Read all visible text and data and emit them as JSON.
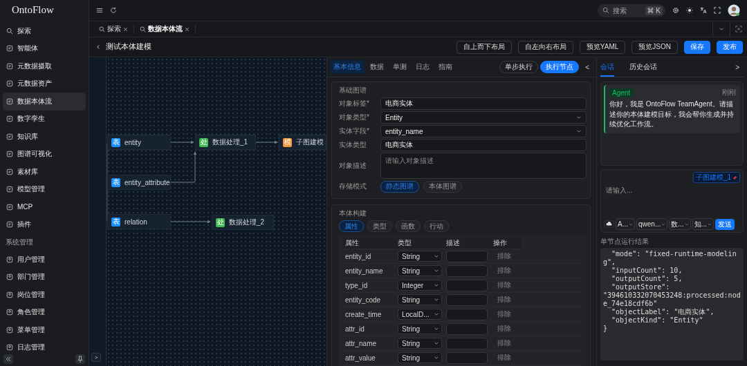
{
  "sidebar": {
    "logo": "OntoFlow",
    "items": [
      {
        "label": "探索",
        "selected": false
      },
      {
        "label": "智能体",
        "selected": false
      },
      {
        "label": "元数据摄取",
        "selected": false
      },
      {
        "label": "元数据资产",
        "selected": false
      },
      {
        "label": "数据本体流",
        "selected": true
      },
      {
        "label": "数字孪生",
        "selected": false
      },
      {
        "label": "知识库",
        "selected": false
      },
      {
        "label": "图谱可视化",
        "selected": false
      },
      {
        "label": "素材库",
        "selected": false
      },
      {
        "label": "模型管理",
        "selected": false
      },
      {
        "label": "MCP",
        "selected": false
      },
      {
        "label": "插件",
        "selected": false
      }
    ],
    "section_label": "系统管理",
    "admin_items": [
      {
        "label": "用户管理",
        "selected": false
      },
      {
        "label": "部门管理",
        "selected": false
      },
      {
        "label": "岗位管理",
        "selected": false
      },
      {
        "label": "角色管理",
        "selected": false
      },
      {
        "label": "菜单管理",
        "selected": false
      },
      {
        "label": "日志管理",
        "selected": false
      }
    ]
  },
  "topbar": {
    "search": {
      "placeholder": "搜索",
      "shortcut": "⌘ K"
    }
  },
  "tabs": [
    {
      "label": "探索",
      "selected": false
    },
    {
      "label": "数据本体流",
      "selected": true
    }
  ],
  "header": {
    "title": "测试本体建模",
    "buttons": [
      {
        "label": "自上而下布局",
        "kind": "outline"
      },
      {
        "label": "自左向右布局",
        "kind": "outline"
      },
      {
        "label": "预览YAML",
        "kind": "outline"
      },
      {
        "label": "预览JSON",
        "kind": "outline"
      },
      {
        "label": "保存",
        "kind": "primary"
      },
      {
        "label": "发布",
        "kind": "primary"
      }
    ]
  },
  "canvas": {
    "nodes": [
      {
        "label": "entity",
        "kind": "table",
        "badge": "表"
      },
      {
        "label": "entity_attribute",
        "kind": "table",
        "badge": "表"
      },
      {
        "label": "relation",
        "kind": "table",
        "badge": "表"
      },
      {
        "label": "数据处理_1",
        "kind": "process",
        "badge": "处"
      },
      {
        "label": "子图建模",
        "kind": "model",
        "badge": "模"
      },
      {
        "label": "数据处理_2",
        "kind": "process",
        "badge": "处"
      }
    ],
    "expand_button": ">"
  },
  "panel": {
    "tabs": [
      {
        "label": "基本信息",
        "selected": true
      },
      {
        "label": "数据",
        "selected": false
      },
      {
        "label": "单测",
        "selected": false
      },
      {
        "label": "日志",
        "selected": false
      },
      {
        "label": "指南",
        "selected": false
      }
    ],
    "actions": [
      {
        "label": "单步执行",
        "kind": "outline"
      },
      {
        "label": "执行节点",
        "kind": "primary"
      }
    ],
    "collapse": "<",
    "basic": {
      "title": "基础图谱",
      "fields": [
        {
          "label": "对象标签*",
          "kind": "input",
          "value": "电商实体"
        },
        {
          "label": "对象类型*",
          "kind": "select",
          "value": "Entity"
        },
        {
          "label": "实体字段*",
          "kind": "select",
          "value": "entity_name"
        },
        {
          "label": "实体类型",
          "kind": "input",
          "value": "电商实体"
        },
        {
          "label": "对象描述",
          "kind": "textarea",
          "placeholder": "请输入对象描述"
        }
      ],
      "storage": {
        "label": "存储模式",
        "options": [
          {
            "label": "静态图谱",
            "selected": true
          },
          {
            "label": "本体图谱",
            "selected": false
          }
        ]
      }
    },
    "build": {
      "title": "本体构建",
      "chips": [
        {
          "label": "属性",
          "selected": true
        },
        {
          "label": "类型",
          "selected": false
        },
        {
          "label": "函数",
          "selected": false
        },
        {
          "label": "行动",
          "selected": false
        }
      ],
      "columns": [
        "属性",
        "类型",
        "描述",
        "操作"
      ],
      "rows": [
        {
          "name": "entity_id",
          "type": "String",
          "action": "排除"
        },
        {
          "name": "entity_name",
          "type": "String",
          "action": "排除"
        },
        {
          "name": "type_id",
          "type": "Integer",
          "action": "排除"
        },
        {
          "name": "entity_code",
          "type": "String",
          "action": "排除"
        },
        {
          "name": "create_time",
          "type": "LocalD...",
          "action": "排除"
        },
        {
          "name": "attr_id",
          "type": "String",
          "action": "排除"
        },
        {
          "name": "attr_name",
          "type": "String",
          "action": "排除"
        },
        {
          "name": "attr_value",
          "type": "String",
          "action": "排除"
        }
      ]
    }
  },
  "chat": {
    "tabs": [
      {
        "label": "会话",
        "selected": true
      },
      {
        "label": "历史会话",
        "selected": false
      }
    ],
    "collapse": ">",
    "message": {
      "tag": "Agent",
      "time": "刚刚",
      "text": "你好，我是 OntoFlow TeamAgent。请描述你的本体建模目标，我会帮你生成并持续优化工作流。"
    },
    "input": {
      "context_chip": "子图建模_1",
      "placeholder": "请输入...",
      "selects": [
        "A...",
        "qwen...",
        "数...",
        "知..."
      ],
      "send": "发送"
    },
    "result": {
      "label": "单节点运行结果",
      "lines": [
        "  \"mode\": \"fixed-runtime-modeling\",",
        "  \"inputCount\": 10,",
        "  \"outputCount\": 5,",
        "  \"outputStore\":",
        "\"394610332070453248:processed:node_74e18cdf6b\"",
        "  \"objectLabel\": \"电商实体\",",
        "  \"objectKind\": \"Entity\"",
        "}"
      ]
    }
  }
}
